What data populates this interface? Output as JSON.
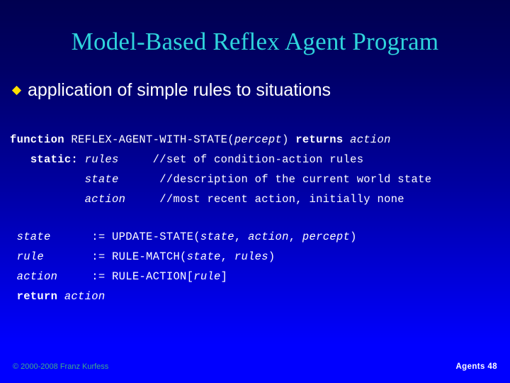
{
  "slide": {
    "title": "Model-Based Reflex Agent Program",
    "background_top_color": "#000050",
    "background_bottom_color": "#0000FF",
    "title_color": "#2FD4DC"
  },
  "bullet": {
    "marker": "diamond-bullet",
    "marker_color": "#FFE000",
    "text": "application of simple rules to situations"
  },
  "code_block_1": {
    "lines": [
      {
        "segments": [
          {
            "text": "function ",
            "style": "bold"
          },
          {
            "text": "REFLEX-AGENT-WITH-STATE(",
            "style": "plain"
          },
          {
            "text": "percept",
            "style": "italic"
          },
          {
            "text": ") ",
            "style": "plain"
          },
          {
            "text": "returns ",
            "style": "bold"
          },
          {
            "text": "action",
            "style": "italic"
          }
        ]
      },
      {
        "segments": [
          {
            "text": "   ",
            "style": "plain"
          },
          {
            "text": "static: ",
            "style": "bold"
          },
          {
            "text": "rules",
            "style": "italic"
          },
          {
            "text": "     //set of condition-action rules",
            "style": "plain"
          }
        ]
      },
      {
        "segments": [
          {
            "text": "           ",
            "style": "plain"
          },
          {
            "text": "state",
            "style": "italic"
          },
          {
            "text": "      //description of the current world state",
            "style": "plain"
          }
        ]
      },
      {
        "segments": [
          {
            "text": "           ",
            "style": "plain"
          },
          {
            "text": "action",
            "style": "italic"
          },
          {
            "text": "     //most recent action, initially none",
            "style": "plain"
          }
        ]
      }
    ]
  },
  "code_block_2": {
    "lines": [
      {
        "segments": [
          {
            "text": " ",
            "style": "plain"
          },
          {
            "text": "state",
            "style": "italic"
          },
          {
            "text": "      := UPDATE-STATE(",
            "style": "plain"
          },
          {
            "text": "state",
            "style": "italic"
          },
          {
            "text": ", ",
            "style": "plain"
          },
          {
            "text": "action",
            "style": "italic"
          },
          {
            "text": ", ",
            "style": "plain"
          },
          {
            "text": "percept",
            "style": "italic"
          },
          {
            "text": ")",
            "style": "plain"
          }
        ]
      },
      {
        "segments": [
          {
            "text": " ",
            "style": "plain"
          },
          {
            "text": "rule",
            "style": "italic"
          },
          {
            "text": "       := RULE-MATCH(",
            "style": "plain"
          },
          {
            "text": "state",
            "style": "italic"
          },
          {
            "text": ", ",
            "style": "plain"
          },
          {
            "text": "rules",
            "style": "italic"
          },
          {
            "text": ")",
            "style": "plain"
          }
        ]
      },
      {
        "segments": [
          {
            "text": " ",
            "style": "plain"
          },
          {
            "text": "action",
            "style": "italic"
          },
          {
            "text": "     := RULE-ACTION[",
            "style": "plain"
          },
          {
            "text": "rule",
            "style": "italic"
          },
          {
            "text": "]",
            "style": "plain"
          }
        ]
      },
      {
        "segments": [
          {
            "text": " ",
            "style": "plain"
          },
          {
            "text": "return ",
            "style": "bold"
          },
          {
            "text": "action",
            "style": "italic"
          }
        ]
      }
    ]
  },
  "footer": {
    "copyright": "© 2000-2008 Franz Kurfess",
    "copyright_color": "#3FA98C",
    "right_label": "Agents",
    "slide_number": "48",
    "right_text": "Agents  48"
  }
}
